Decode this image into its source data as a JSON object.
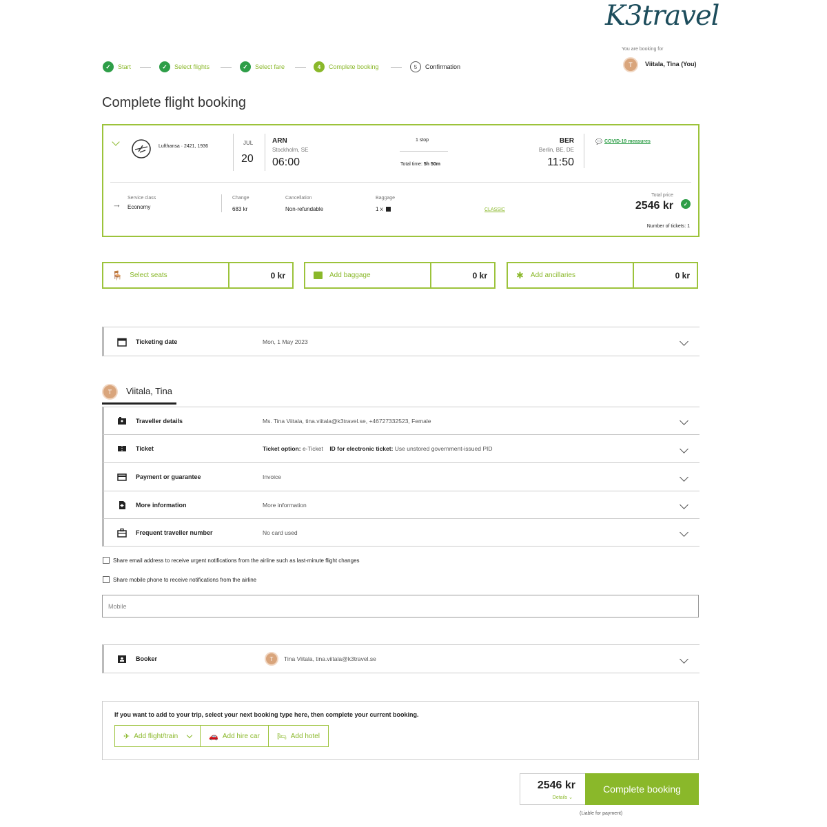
{
  "logo": {
    "text": "K3travel"
  },
  "progress": {
    "steps": [
      {
        "label": "Start",
        "state": "done"
      },
      {
        "label": "Select flights",
        "state": "done"
      },
      {
        "label": "Select fare",
        "state": "done"
      },
      {
        "label": "Complete booking",
        "state": "active",
        "number": "4"
      },
      {
        "label": "Confirmation",
        "state": "todo",
        "number": "5"
      }
    ]
  },
  "booking_for": {
    "label": "You are booking for",
    "avatar": "T",
    "name": "Viitala, Tina (You)"
  },
  "page_title": "Complete flight booking",
  "flight": {
    "airline": "Lufthansa · 2421, 1936",
    "month": "JUL",
    "day": "20",
    "origin_code": "ARN",
    "origin_city": "Stockholm, SE",
    "depart_time": "06:00",
    "stops": "1 stop",
    "total_time_label": "Total time:",
    "total_time": "5h 50m",
    "dest_code": "BER",
    "dest_city": "Berlin, BE, DE",
    "arrive_time": "11:50",
    "covid_link": "COVID-19 measures",
    "service_class_label": "Service class",
    "service_class": "Economy",
    "change_label": "Change",
    "change_value": "683 kr",
    "cancellation_label": "Cancellation",
    "cancellation_value": "Non-refundable",
    "baggage_label": "Baggage",
    "baggage_value": "1 x",
    "fare_link": "CLASSIC",
    "total_price_label": "Total price",
    "total_price": "2546 kr",
    "tickets_label": "Number of tickets: 1"
  },
  "addons": [
    {
      "label": "Select seats",
      "price": "0 kr",
      "icon": "seat-icon"
    },
    {
      "label": "Add baggage",
      "price": "0 kr",
      "icon": "baggage-icon"
    },
    {
      "label": "Add ancillaries",
      "price": "0 kr",
      "icon": "puzzle-icon"
    }
  ],
  "ticketing": {
    "label": "Ticketing date",
    "value": "Mon, 1 May 2023"
  },
  "traveller": {
    "avatar": "T",
    "name": "Viitala, Tina",
    "rows": [
      {
        "label": "Traveller details",
        "value": "Ms. Tina Viitala, tina.viitala@k3travel.se, +46727332523, Female",
        "icon": "id-card-icon"
      },
      {
        "label": "Ticket",
        "value_bold1": "Ticket option:",
        "value1": " e-Ticket",
        "value_bold2": "ID for electronic ticket:",
        "value2": " Use unstored government-issued PID",
        "icon": "ticket-icon"
      },
      {
        "label": "Payment or guarantee",
        "value": "Invoice",
        "icon": "credit-card-icon"
      },
      {
        "label": "More information",
        "value": "More information",
        "icon": "document-icon"
      },
      {
        "label": "Frequent traveller number",
        "value": "No card used",
        "icon": "briefcase-icon"
      }
    ]
  },
  "share": {
    "email": "Share email address to receive urgent notifications from the airline such as last-minute flight changes",
    "mobile": "Share mobile phone to receive notifications from the airline"
  },
  "mobile_placeholder": "Mobile",
  "booker": {
    "label": "Booker",
    "avatar": "T",
    "value": "Tina Viitala, tina.viitala@k3travel.se"
  },
  "add_trip": {
    "text": "If you want to add to your trip, select your next booking type here, then complete your current booking.",
    "buttons": [
      "Add flight/train",
      "Add hire car",
      "Add hotel"
    ]
  },
  "footer": {
    "total": "2546 kr",
    "details": "Details",
    "complete": "Complete booking",
    "liable": "(Liable for payment)"
  },
  "colors": {
    "accent": "#8ab82a",
    "done": "#2e9e48",
    "logo": "#1d4d5c"
  }
}
